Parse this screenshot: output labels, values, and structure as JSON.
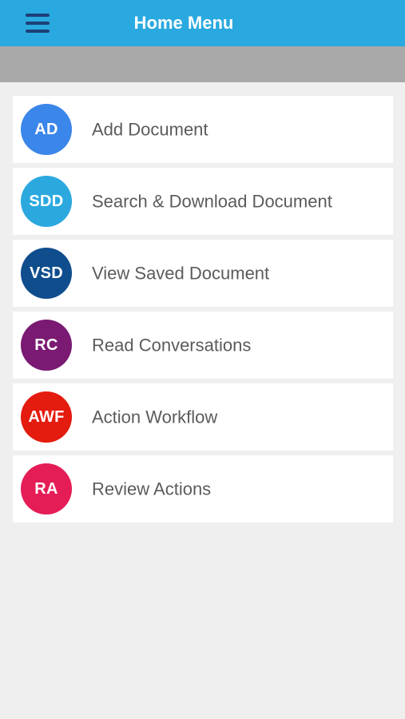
{
  "header": {
    "title": "Home Menu",
    "menu_icon": "hamburger-menu-icon",
    "background": "#29a9df"
  },
  "menu": {
    "items": [
      {
        "abbr": "AD",
        "label": "Add Document",
        "color": "#3b86ea"
      },
      {
        "abbr": "SDD",
        "label": "Search & Download Document",
        "color": "#2ba9df"
      },
      {
        "abbr": "VSD",
        "label": "View Saved Document",
        "color": "#0f4d8d"
      },
      {
        "abbr": "RC",
        "label": "Read Conversations",
        "color": "#7a1a73"
      },
      {
        "abbr": "AWF",
        "label": "Action Workflow",
        "color": "#e41b0f"
      },
      {
        "abbr": "RA",
        "label": "Review Actions",
        "color": "#e51d57"
      }
    ]
  }
}
